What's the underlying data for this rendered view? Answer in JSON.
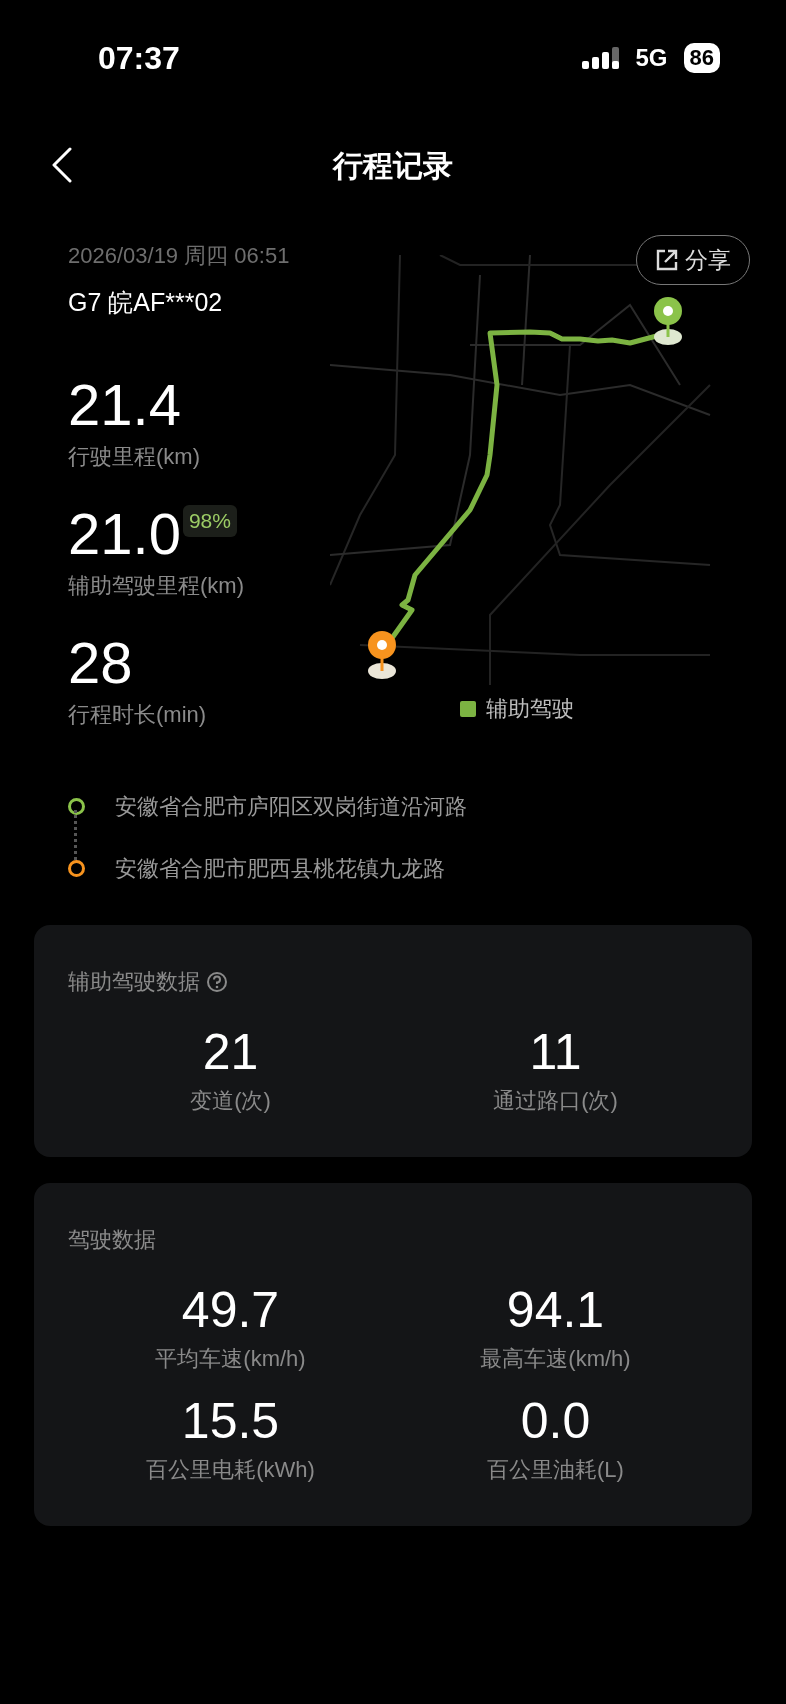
{
  "status_bar": {
    "time": "07:37",
    "network": "5G",
    "battery": "86"
  },
  "header": {
    "title": "行程记录"
  },
  "trip": {
    "datetime": "2026/03/19 周四 06:51",
    "vehicle": "G7 皖AF***02",
    "share_label": "分享",
    "stats": [
      {
        "value": "21.4",
        "label": "行驶里程(km)"
      },
      {
        "value": "21.0",
        "badge": "98%",
        "label": "辅助驾驶里程(km)"
      },
      {
        "value": "28",
        "label": "行程时长(min)"
      }
    ],
    "legend": {
      "label": "辅助驾驶",
      "color": "#7cb342"
    }
  },
  "route": [
    {
      "address": "安徽省合肥市庐阳区双岗街道沿河路",
      "color": "#8bc34a"
    },
    {
      "address": "安徽省合肥市肥西县桃花镇九龙路",
      "color": "#f7931e"
    }
  ],
  "cards": [
    {
      "title": "辅助驾驶数据",
      "help": true,
      "metrics": [
        {
          "value": "21",
          "label": "变道(次)"
        },
        {
          "value": "11",
          "label": "通过路口(次)"
        }
      ]
    },
    {
      "title": "驾驶数据",
      "help": false,
      "metrics": [
        {
          "value": "49.7",
          "label": "平均车速(km/h)"
        },
        {
          "value": "94.1",
          "label": "最高车速(km/h)"
        },
        {
          "value": "15.5",
          "label": "百公里电耗(kWh)"
        },
        {
          "value": "0.0",
          "label": "百公里油耗(L)"
        }
      ]
    }
  ]
}
